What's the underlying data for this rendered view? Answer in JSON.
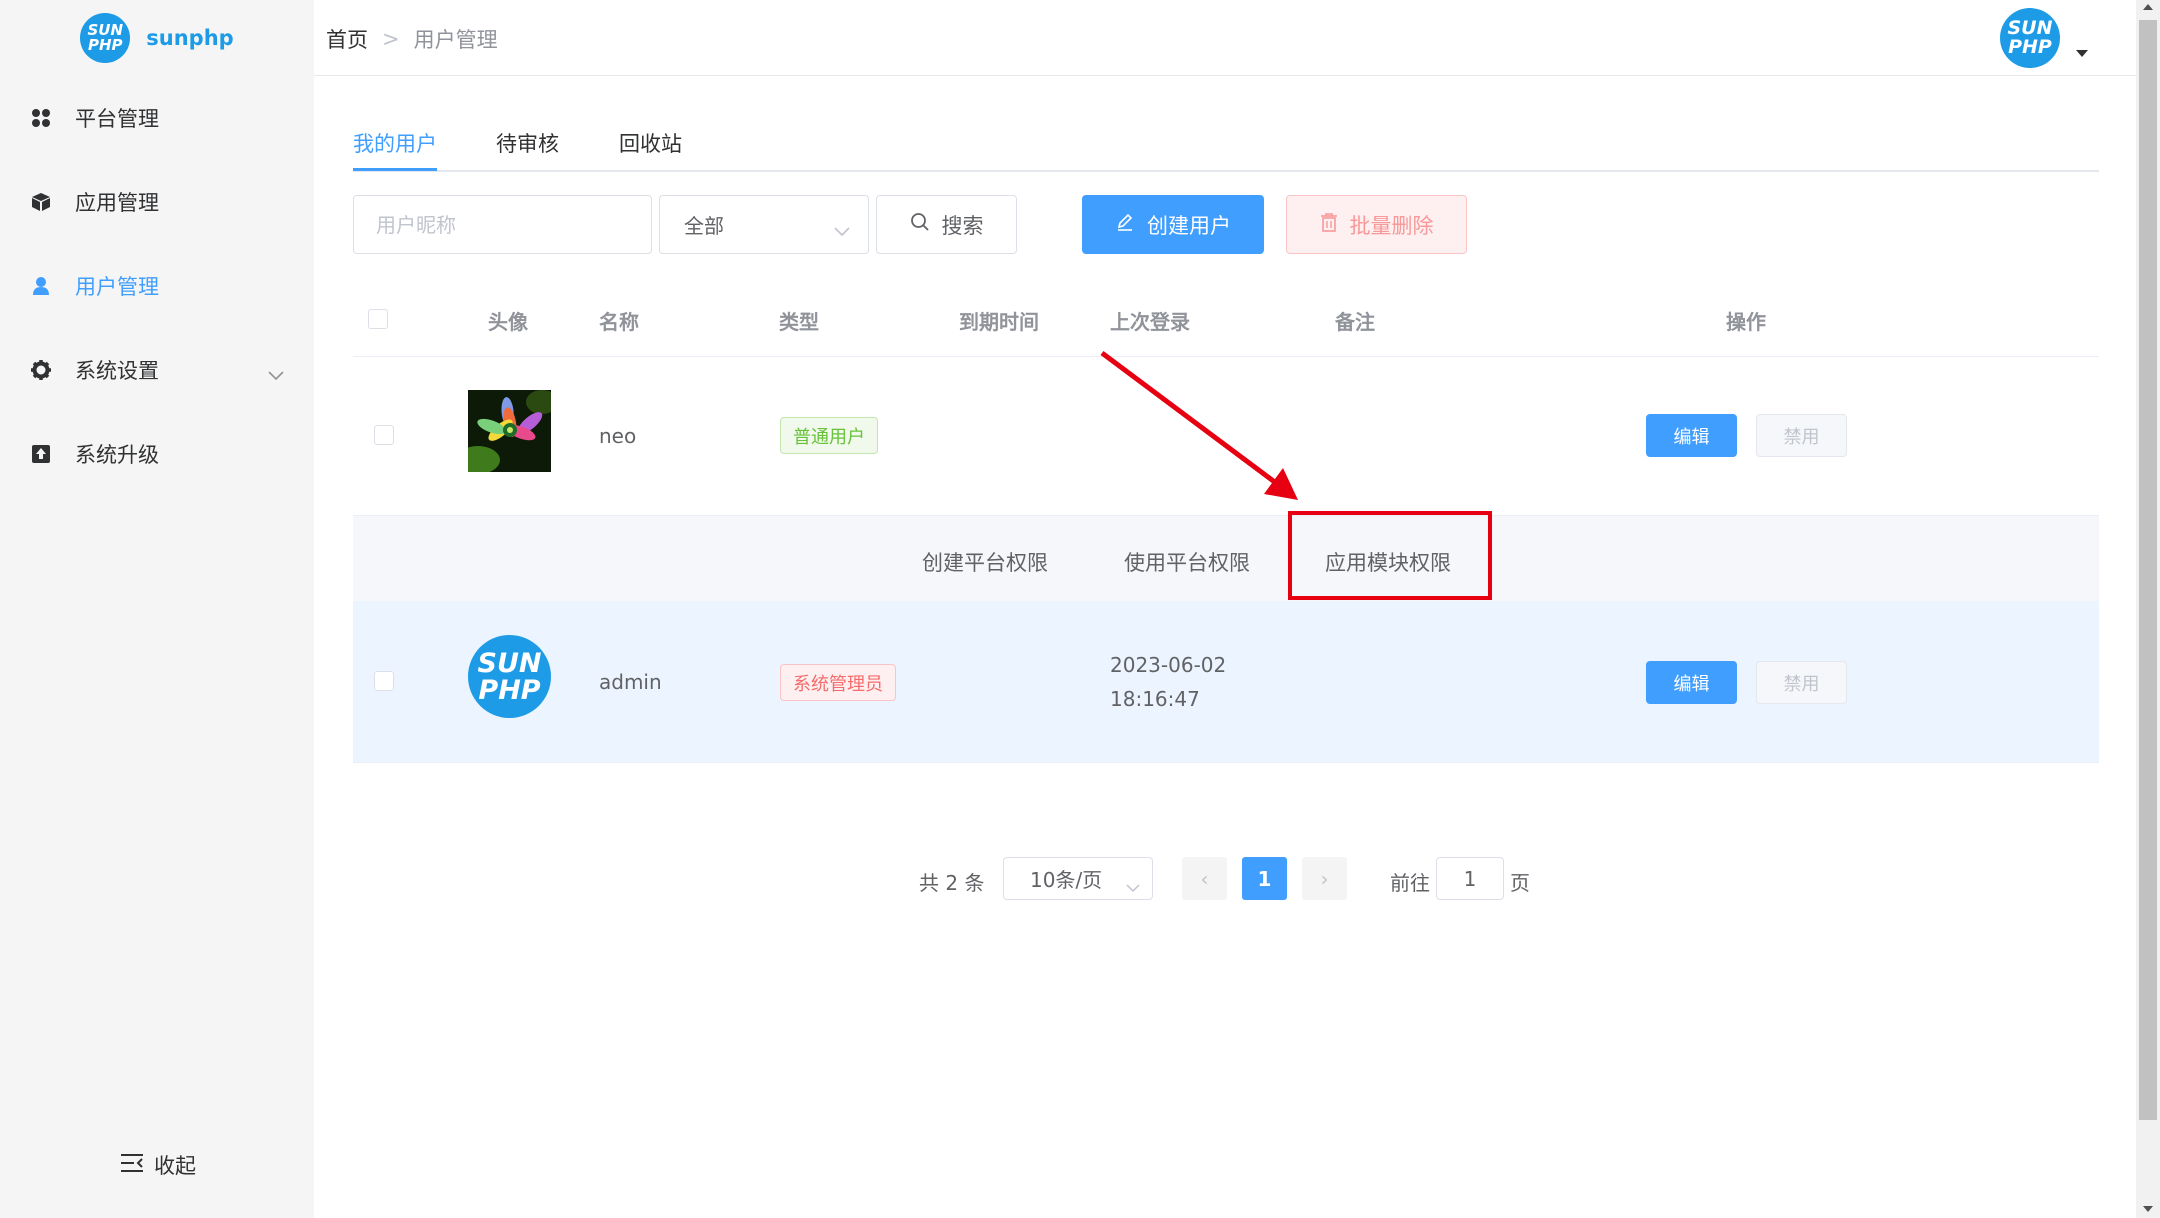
{
  "brand": {
    "name": "sunphp",
    "badge_line1": "SUN",
    "badge_line2": "PHP"
  },
  "sidebar": {
    "items": [
      {
        "label": "平台管理",
        "icon": "grid-icon"
      },
      {
        "label": "应用管理",
        "icon": "cube-icon"
      },
      {
        "label": "用户管理",
        "icon": "user-icon",
        "active": true
      },
      {
        "label": "系统设置",
        "icon": "gear-icon",
        "expandable": true
      },
      {
        "label": "系统升级",
        "icon": "upload-icon"
      }
    ],
    "collapse_label": "收起"
  },
  "header": {
    "breadcrumb": {
      "home": "首页",
      "separator": ">",
      "current": "用户管理"
    },
    "avatar": {
      "line1": "SUN",
      "line2": "PHP"
    }
  },
  "tabs": [
    {
      "label": "我的用户",
      "active": true
    },
    {
      "label": "待审核"
    },
    {
      "label": "回收站"
    }
  ],
  "toolbar": {
    "nickname_placeholder": "用户昵称",
    "type_select_value": "全部",
    "search_label": "搜索",
    "create_label": "创建用户",
    "bulk_delete_label": "批量删除"
  },
  "table": {
    "headers": {
      "avatar": "头像",
      "name": "名称",
      "type": "类型",
      "expire": "到期时间",
      "last_login": "上次登录",
      "remark": "备注",
      "actions": "操作"
    },
    "rows": [
      {
        "name": "neo",
        "type_tag": "普通用户",
        "expire": "",
        "last_login_date": "",
        "last_login_time": "",
        "remark": "",
        "edit_label": "编辑",
        "disable_label": "禁用"
      },
      {
        "name": "admin",
        "type_tag": "系统管理员",
        "expire": "",
        "last_login_date": "2023-06-02",
        "last_login_time": "18:16:47",
        "remark": "",
        "edit_label": "编辑",
        "disable_label": "禁用",
        "avatar_line1": "SUN",
        "avatar_line2": "PHP"
      }
    ],
    "permission_menu": [
      "创建平台权限",
      "使用平台权限",
      "应用模块权限"
    ]
  },
  "pagination": {
    "total_text": "共 2 条",
    "page_size": "10条/页",
    "prev": "‹",
    "current_page": "1",
    "next": "›",
    "goto_label": "前往",
    "goto_value": "1",
    "page_suffix": "页"
  },
  "colors": {
    "primary": "#409eff",
    "brand": "#1d9be6",
    "annotation": "#e60012"
  }
}
